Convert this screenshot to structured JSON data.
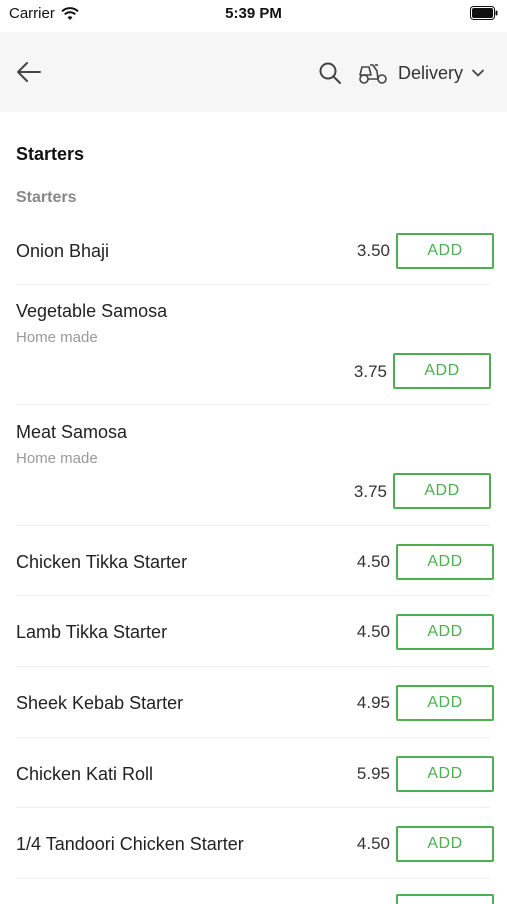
{
  "status_bar": {
    "carrier": "Carrier",
    "time": "5:39 PM"
  },
  "header": {
    "mode_label": "Delivery"
  },
  "section": {
    "title": "Starters",
    "subtitle": "Starters"
  },
  "items": [
    {
      "name": "Onion Bhaji",
      "desc": "",
      "price": "3.50",
      "add": "ADD"
    },
    {
      "name": "Vegetable Samosa",
      "desc": "Home made",
      "price": "3.75",
      "add": "ADD"
    },
    {
      "name": "Meat Samosa",
      "desc": "Home made",
      "price": "3.75",
      "add": "ADD"
    },
    {
      "name": "Chicken Tikka Starter",
      "desc": "",
      "price": "4.50",
      "add": "ADD"
    },
    {
      "name": "Lamb Tikka Starter",
      "desc": "",
      "price": "4.50",
      "add": "ADD"
    },
    {
      "name": "Sheek Kebab Starter",
      "desc": "",
      "price": "4.95",
      "add": "ADD"
    },
    {
      "name": "Chicken Kati Roll",
      "desc": "",
      "price": "5.95",
      "add": "ADD"
    },
    {
      "name": "1/4 Tandoori Chicken Starter",
      "desc": "",
      "price": "4.50",
      "add": "ADD"
    }
  ],
  "colors": {
    "accent": "#4caf50",
    "header_bg": "#f6f6f6"
  }
}
